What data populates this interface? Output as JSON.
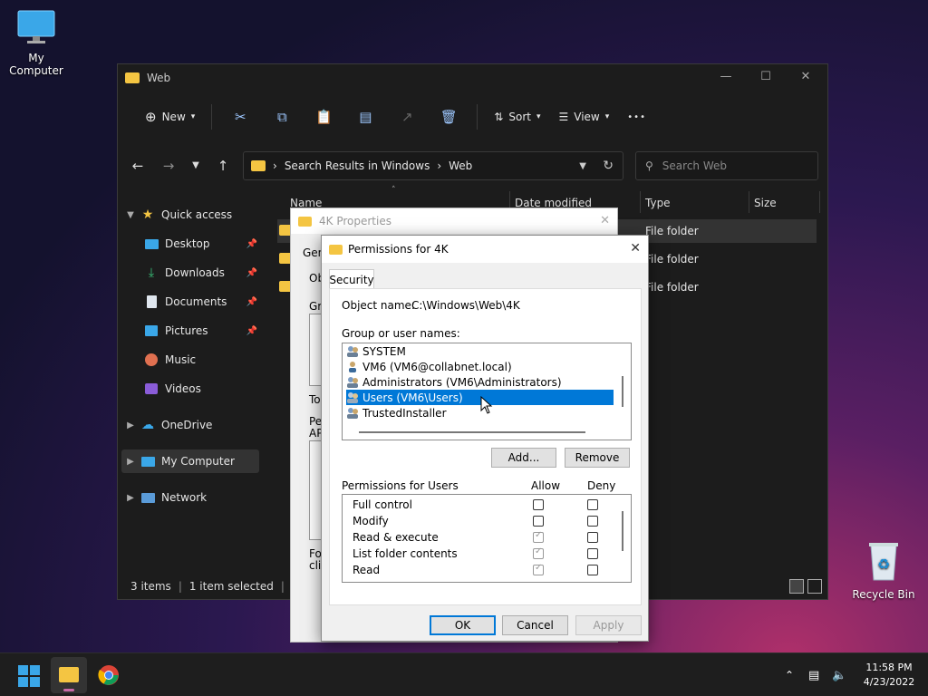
{
  "desktop": {
    "my_computer_label": "My Computer",
    "recycle_bin_label": "Recycle Bin"
  },
  "explorer": {
    "title": "Web",
    "toolbar": {
      "new_label": "New",
      "sort_label": "Sort",
      "view_label": "View",
      "more_label": "•••"
    },
    "address": {
      "path_root": "Search Results in Windows",
      "path_sep": "›",
      "path_leaf": "Web"
    },
    "search": {
      "placeholder": "Search Web"
    },
    "sidebar": {
      "quick_access": "Quick access",
      "items": [
        {
          "label": "Desktop"
        },
        {
          "label": "Downloads"
        },
        {
          "label": "Documents"
        },
        {
          "label": "Pictures"
        },
        {
          "label": "Music"
        },
        {
          "label": "Videos"
        }
      ],
      "onedrive": "OneDrive",
      "my_computer": "My Computer",
      "network": "Network"
    },
    "columns": {
      "name": "Name",
      "date_modified": "Date modified",
      "type": "Type",
      "size": "Size"
    },
    "rows": [
      {
        "type": "File folder"
      },
      {
        "type": "File folder"
      },
      {
        "type": "File folder"
      }
    ],
    "status": {
      "items": "3 items",
      "selected": "1 item selected"
    }
  },
  "props_dialog": {
    "title": "4K Properties",
    "frag_gen": "Gen",
    "frag_ob": "Ob",
    "frag_gr": "Gro",
    "frag_to": "To",
    "frag_pe": "Pe",
    "frag_ap": "AP",
    "frag_fo": "For",
    "frag_cl": "clic"
  },
  "perm_dialog": {
    "title": "Permissions for 4K",
    "tab": "Security",
    "object_name_label": "Object name:",
    "object_name_value": "C:\\Windows\\Web\\4K",
    "group_label": "Group or user names:",
    "users": [
      {
        "name": "SYSTEM"
      },
      {
        "name": "VM6 (VM6@collabnet.local)"
      },
      {
        "name": "Administrators (VM6\\Administrators)"
      },
      {
        "name": "Users (VM6\\Users)"
      },
      {
        "name": "TrustedInstaller"
      }
    ],
    "add_label": "Add...",
    "remove_label": "Remove",
    "permissions_label": "Permissions for Users",
    "allow_label": "Allow",
    "deny_label": "Deny",
    "permissions": [
      {
        "name": "Full control",
        "allow": false,
        "deny": false
      },
      {
        "name": "Modify",
        "allow": false,
        "deny": false
      },
      {
        "name": "Read & execute",
        "allow": true,
        "deny": false
      },
      {
        "name": "List folder contents",
        "allow": true,
        "deny": false
      },
      {
        "name": "Read",
        "allow": true,
        "deny": false
      }
    ],
    "ok_label": "OK",
    "cancel_label": "Cancel",
    "apply_label": "Apply"
  },
  "taskbar": {
    "time": "11:58 PM",
    "date": "4/23/2022"
  },
  "colors": {
    "accent": "#0078d7",
    "folder": "#f4c542"
  }
}
